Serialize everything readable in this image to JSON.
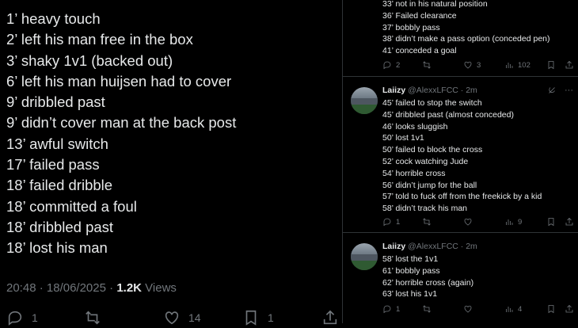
{
  "main_post": {
    "lines": [
      "1’ heavy touch",
      "2’ left his man free in the box",
      "3’ shaky 1v1 (backed out)",
      "6’ left his man huijsen had to cover",
      "9’ dribbled past",
      "9’ didn’t cover man at the back post",
      "13’ awful switch",
      "17’ failed pass",
      "18’ failed dribble",
      "18’ committed a foul",
      "18’ dribbled past",
      "18’ lost his man"
    ],
    "time": "20:48",
    "dot": " · ",
    "date": "18/06/2025",
    "views_count": "1.2K",
    "views_label": " Views",
    "actions": {
      "replies": "1",
      "reposts": "",
      "likes": "14",
      "bookmarks": "1"
    }
  },
  "replies": {
    "top_tweet": {
      "lines": [
        "33’ not in his natural position",
        "36’ Failed clearance",
        "37’ bobbly pass",
        "38’ didn’t make a pass option (conceded pen)",
        "41’ conceded a goal"
      ],
      "actions": {
        "replies": "2",
        "reposts": "",
        "likes": "3",
        "views": "102"
      }
    },
    "tweet2": {
      "name": "Laiizy",
      "handle": "@AlexxLFCC",
      "time": "2m",
      "lines": [
        "45’ failed to stop the switch",
        "45’ dribbled past (almost conceded)",
        "46’ looks sluggish",
        "50’ lost 1v1",
        "50’ failed to block the cross",
        " 52’ cock watching Jude",
        "54’ horrible cross",
        "56’ didn’t jump for the ball",
        "57’ told to fuck off from the freekick by a kid",
        "58’ didn’t track his man"
      ],
      "actions": {
        "replies": "1",
        "reposts": "",
        "likes": "",
        "views": "9"
      }
    },
    "tweet3": {
      "name": "Laiizy",
      "handle": "@AlexxLFCC",
      "time": "2m",
      "lines": [
        "58’ lost the 1v1",
        "61’ bobbly pass",
        "62’ horrible cross (again)",
        "63’ lost his 1v1"
      ],
      "actions": {
        "replies": "1",
        "reposts": "",
        "likes": "",
        "views": "4"
      }
    },
    "more_label": "···",
    "separator": " · "
  },
  "icons": [
    "reply-icon",
    "repost-icon",
    "like-icon",
    "bookmark-icon",
    "share-icon",
    "views-icon",
    "grok-icon",
    "more-icon"
  ],
  "colors": {
    "background": "#000000",
    "text": "#e7e9ea",
    "muted": "#71767b",
    "border": "#2f3336"
  }
}
